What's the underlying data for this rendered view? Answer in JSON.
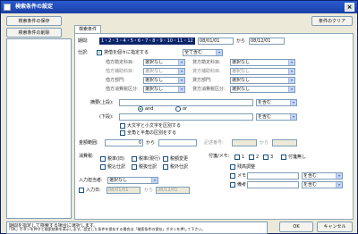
{
  "window": {
    "title": "検索条件の設定",
    "close": "×"
  },
  "left": {
    "save_btn": "検索条件の保存",
    "delete_btn": "検索条件の削除"
  },
  "top": {
    "clear_btn": "条件のクリア",
    "tab": "検索条件"
  },
  "period": {
    "label": "期間:",
    "segments": "1・2・3・4・5・6・7・8・9・10・11・12",
    "from": "08/01/01",
    "kara": "から",
    "to": "08/12/01"
  },
  "accounts": {
    "label": "仕訳:",
    "shitei_label": "貸借を個々に指定する",
    "scope": "全て含む",
    "rows": [
      {
        "left_label": "借方勘定科目:",
        "left_val": "選択なし",
        "right_label": "貸方勘定科目:",
        "right_val": "選択なし"
      },
      {
        "left_label": "借方補助科目:",
        "left_val": "選択なし",
        "right_label": "貸方補助科目:",
        "right_val": "選択なし"
      },
      {
        "left_label": "借方部門:",
        "left_val": "選択なし",
        "right_label": "貸方部門:",
        "right_val": "選択なし"
      },
      {
        "left_label": "借方消費税区分:",
        "left_val": "選択なし",
        "right_label": "貸方消費税区分:",
        "right_val": "選択なし"
      }
    ]
  },
  "memo": {
    "label1": "摘要(上段):",
    "contains1": "を含む",
    "and_label": "and",
    "or_label": "or",
    "label2": "(下段):",
    "contains2": "を含む",
    "case_label": "大文字と小文字を区別する",
    "width_label": "全角と半角の区別をする"
  },
  "amount": {
    "label": "金額範囲:",
    "from": "0",
    "kara": "から",
    "reg_label": "記述番号:",
    "reg_kara": "から"
  },
  "tax": {
    "label": "消費税:",
    "opts": [
      "税率(旧)",
      "税率(現行)",
      "税額変更",
      "税込仕訳",
      "税抜仕訳",
      "税外仕訳"
    ]
  },
  "sticky": {
    "label": "付箋/メモ:",
    "colors": [
      "1",
      "2",
      "3"
    ],
    "no_sticky": "付箋無し",
    "unmatched": "残高調整",
    "memo_label": "メモ",
    "memo_contains": "を含む",
    "note_label": "備考",
    "note_contains": "を含む"
  },
  "input": {
    "person_label": "入力担当者:",
    "person_val": "選択なし",
    "date_label": "入力日:",
    "date_from": "08/01/01",
    "kara": "から",
    "date_to": "08/12/01"
  },
  "info": {
    "line1": "期間を指定して検索する場合に選択します。",
    "line2": "「OK」ボタンを押すと検索結果を表示します。設定した条件を保存する場合は「検索条件の保存」ボタンを押して下さい。"
  },
  "footer": {
    "ok": "OK",
    "cancel": "キャンセル"
  }
}
